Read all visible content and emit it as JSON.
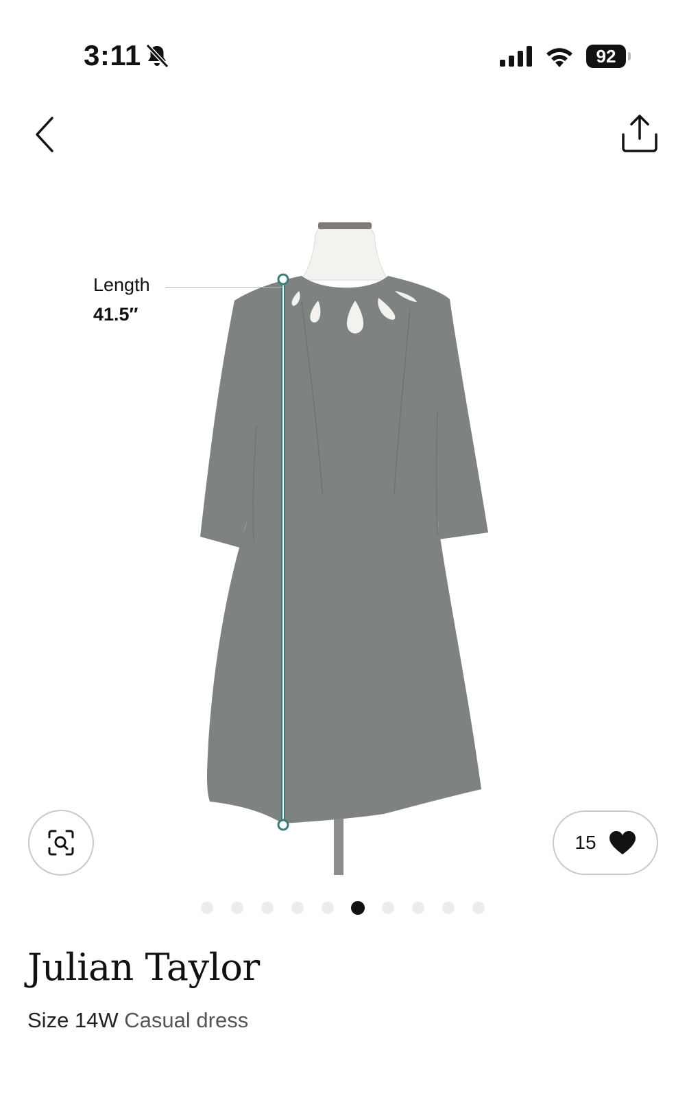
{
  "status_bar": {
    "time": "3:11",
    "battery": "92",
    "icons": [
      "bell-slash-icon",
      "signal-icon",
      "wifi-icon",
      "battery-icon"
    ]
  },
  "nav": {
    "back_icon": "chevron-left-icon",
    "share_icon": "share-icon"
  },
  "measurement": {
    "label": "Length",
    "value": "41.5″",
    "line_color": "#3a7d78"
  },
  "actions": {
    "visual_search_icon": "visual-search-icon",
    "like_count": "15",
    "like_icon": "heart-icon"
  },
  "gallery": {
    "total_images": 10,
    "active_index": 5
  },
  "product": {
    "brand": "Julian Taylor",
    "size": "Size 14W",
    "category": "Casual dress",
    "dress_color": "#808482"
  }
}
